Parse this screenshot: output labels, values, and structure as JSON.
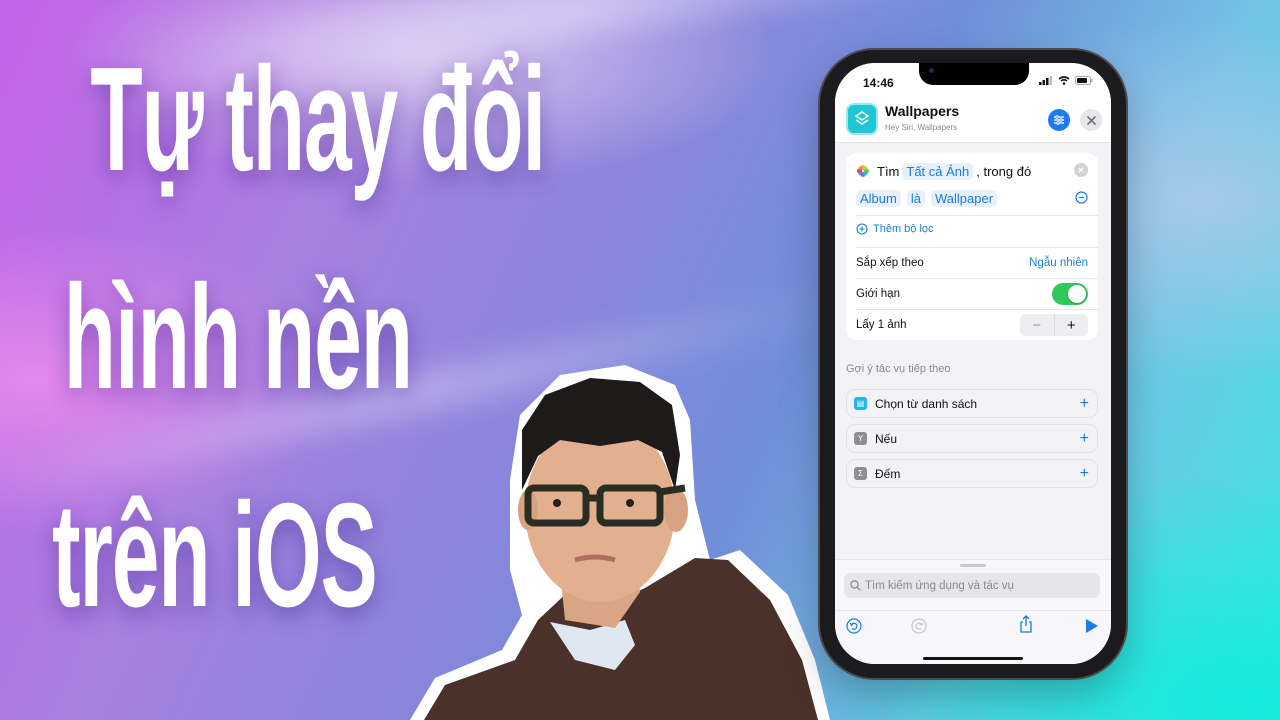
{
  "thumbnail": {
    "title_lines": [
      "Tự thay đổi",
      "hình nền",
      "trên iOS"
    ],
    "colors": {
      "title_text": "#ffffff",
      "arrow": "#ff1f6e",
      "bg_start": "#c462e8",
      "bg_end": "#3fe6e0"
    }
  },
  "phone": {
    "status_bar": {
      "time": "14:46",
      "icons": [
        "signal-icon",
        "wifi-icon",
        "battery-icon"
      ]
    },
    "header": {
      "app_icon": "shortcuts-layers-icon",
      "title": "Wallpapers",
      "subtitle": "Hey Siri, Wallpapers",
      "settings_icon": "sliders-icon",
      "close_icon": "close-icon"
    },
    "action_card": {
      "row1": {
        "icon": "photos-icon",
        "verb": "Tìm",
        "token": "Tất cả Ảnh",
        "suffix": ", trong đó"
      },
      "filter": {
        "field": "Album",
        "operator": "là",
        "value": "Wallpaper"
      },
      "add_filter": "Thêm bộ lọc",
      "sort": {
        "label": "Sắp xếp theo",
        "value": "Ngẫu nhiên"
      },
      "limit": {
        "label": "Giới hạn",
        "enabled": true
      },
      "take": {
        "label": "Lấy 1 ảnh",
        "count": 1,
        "dec": "−",
        "inc": "+"
      }
    },
    "suggestions": {
      "label": "Gợi ý tác vụ tiếp theo",
      "items": [
        {
          "label": "Chọn từ danh sách",
          "icon": "list-icon",
          "color": "#22b5e8"
        },
        {
          "label": "Nếu",
          "icon": "branch-icon",
          "color": "#8e8e93"
        },
        {
          "label": "Đếm",
          "icon": "sigma-icon",
          "color": "#8e8e93"
        }
      ],
      "add": "+"
    },
    "bottom": {
      "search_placeholder": "Tìm kiếm ứng dụng và tác vụ",
      "toolbar": [
        "undo-icon",
        "redo-icon",
        "share-icon",
        "play-icon"
      ]
    },
    "colors": {
      "accent": "#1a7cd8",
      "toggle_on": "#30c85a",
      "app_icon": "#1fc7d4"
    }
  }
}
